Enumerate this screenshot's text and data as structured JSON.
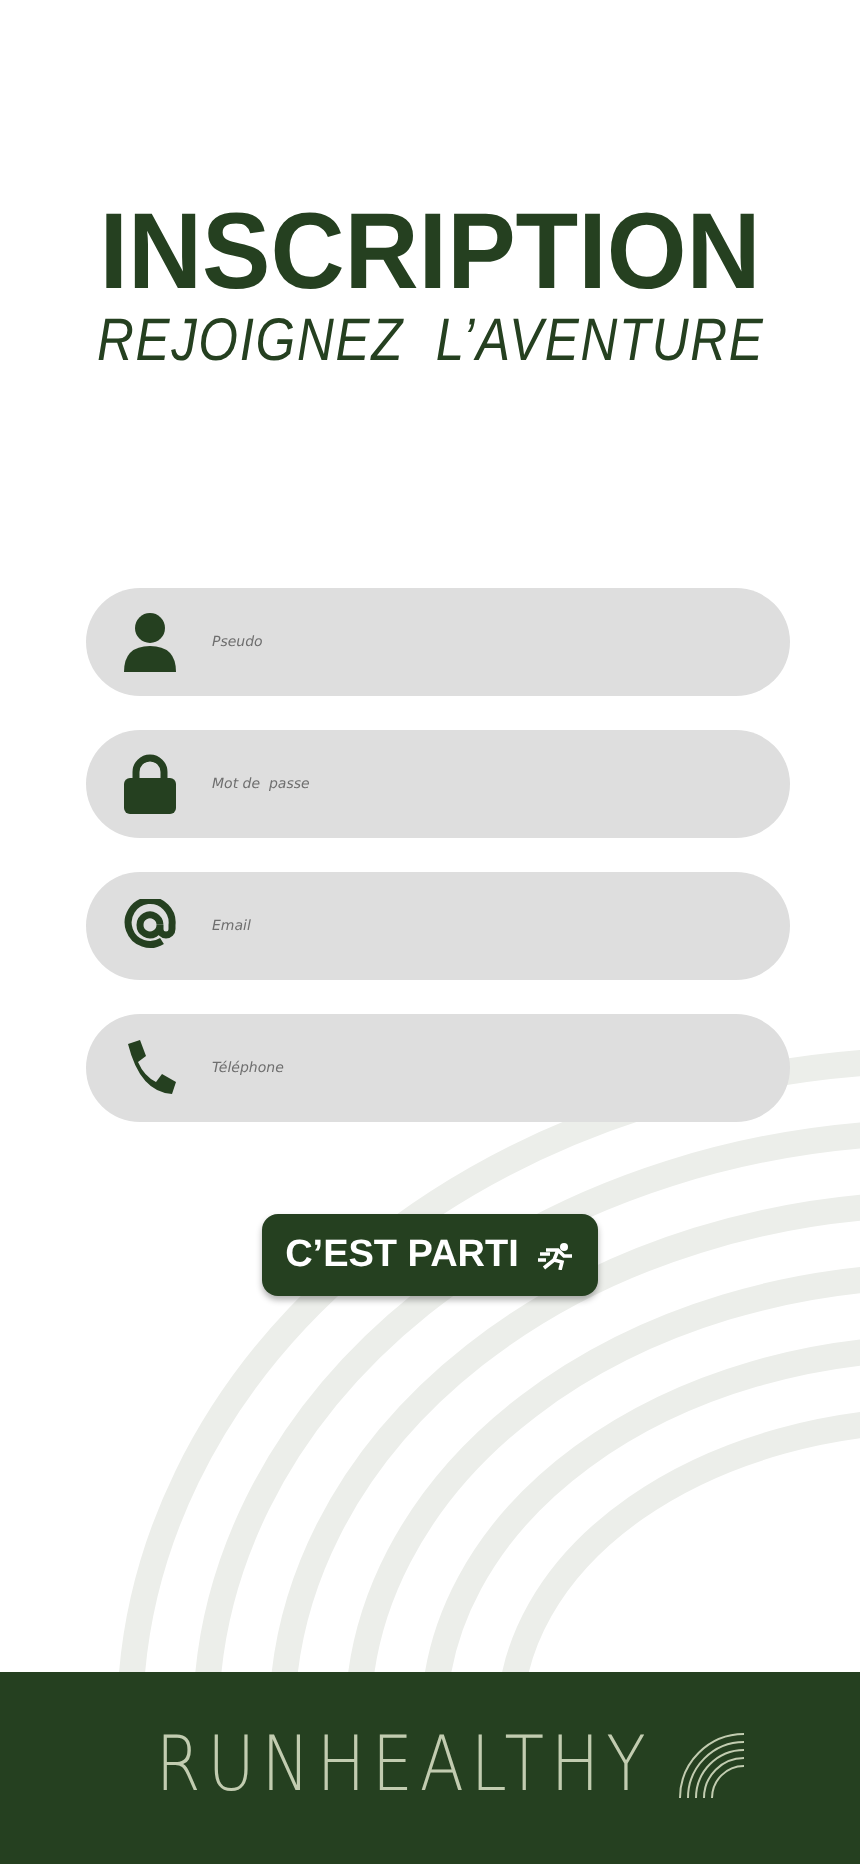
{
  "title": "INSCRIPTION",
  "subtitle": "REJOIGNEZ  L’AVENTURE",
  "fields": [
    {
      "kind": "user",
      "placeholder": "Pseudo"
    },
    {
      "kind": "lock",
      "placeholder": "Mot de  passe"
    },
    {
      "kind": "at",
      "placeholder": "Email"
    },
    {
      "kind": "phone",
      "placeholder": "Téléphone"
    }
  ],
  "submit": {
    "label": "C’EST PARTI"
  },
  "footer": {
    "brand": "RUNHEALTHY"
  }
}
